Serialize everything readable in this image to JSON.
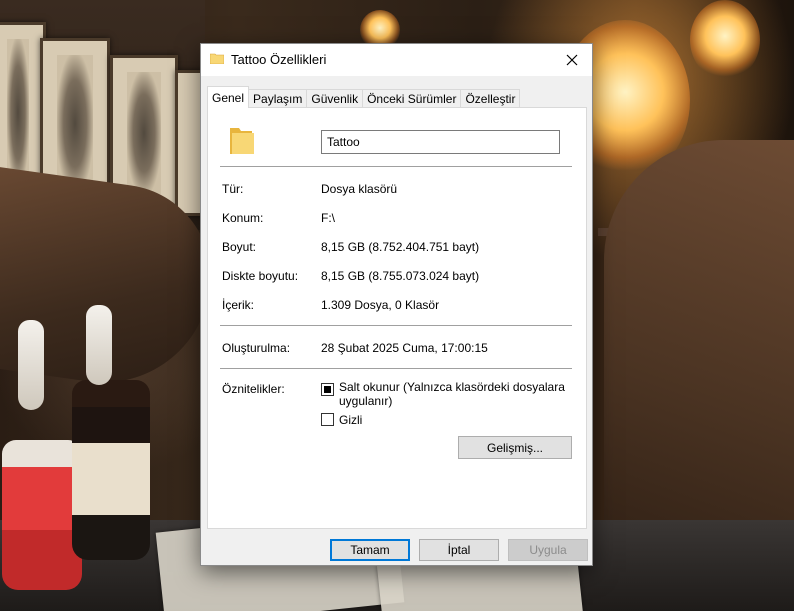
{
  "window": {
    "title": "Tattoo Özellikleri"
  },
  "tabs": [
    {
      "label": "Genel",
      "active": true
    },
    {
      "label": "Paylaşım",
      "active": false
    },
    {
      "label": "Güvenlik",
      "active": false
    },
    {
      "label": "Önceki Sürümler",
      "active": false
    },
    {
      "label": "Özelleştir",
      "active": false
    }
  ],
  "general": {
    "folder_name": "Tattoo",
    "type_label": "Tür:",
    "type_value": "Dosya klasörü",
    "location_label": "Konum:",
    "location_value": "F:\\",
    "size_label": "Boyut:",
    "size_value": "8,15 GB (8.752.404.751 bayt)",
    "disk_size_label": "Diskte boyutu:",
    "disk_size_value": "8,15 GB (8.755.073.024 bayt)",
    "contents_label": "İçerik:",
    "contents_value": "1.309 Dosya, 0 Klasör",
    "created_label": "Oluşturulma:",
    "created_value": "28 Şubat 2025 Cuma, 17:00:15",
    "attributes_label": "Öznitelikler:",
    "readonly_label_line1": "Salt okunur (Yalnızca klasördeki dosyalara",
    "readonly_label_line2": "uygulanır)",
    "readonly_checked": true,
    "hidden_label": "Gizli",
    "hidden_checked": false,
    "advanced_button": "Gelişmiş..."
  },
  "footer": {
    "ok_label": "Tamam",
    "cancel_label": "İptal",
    "apply_label": "Uygula"
  },
  "colors": {
    "folder_yellow": "#f8d775",
    "focus_blue": "#0078d7"
  }
}
